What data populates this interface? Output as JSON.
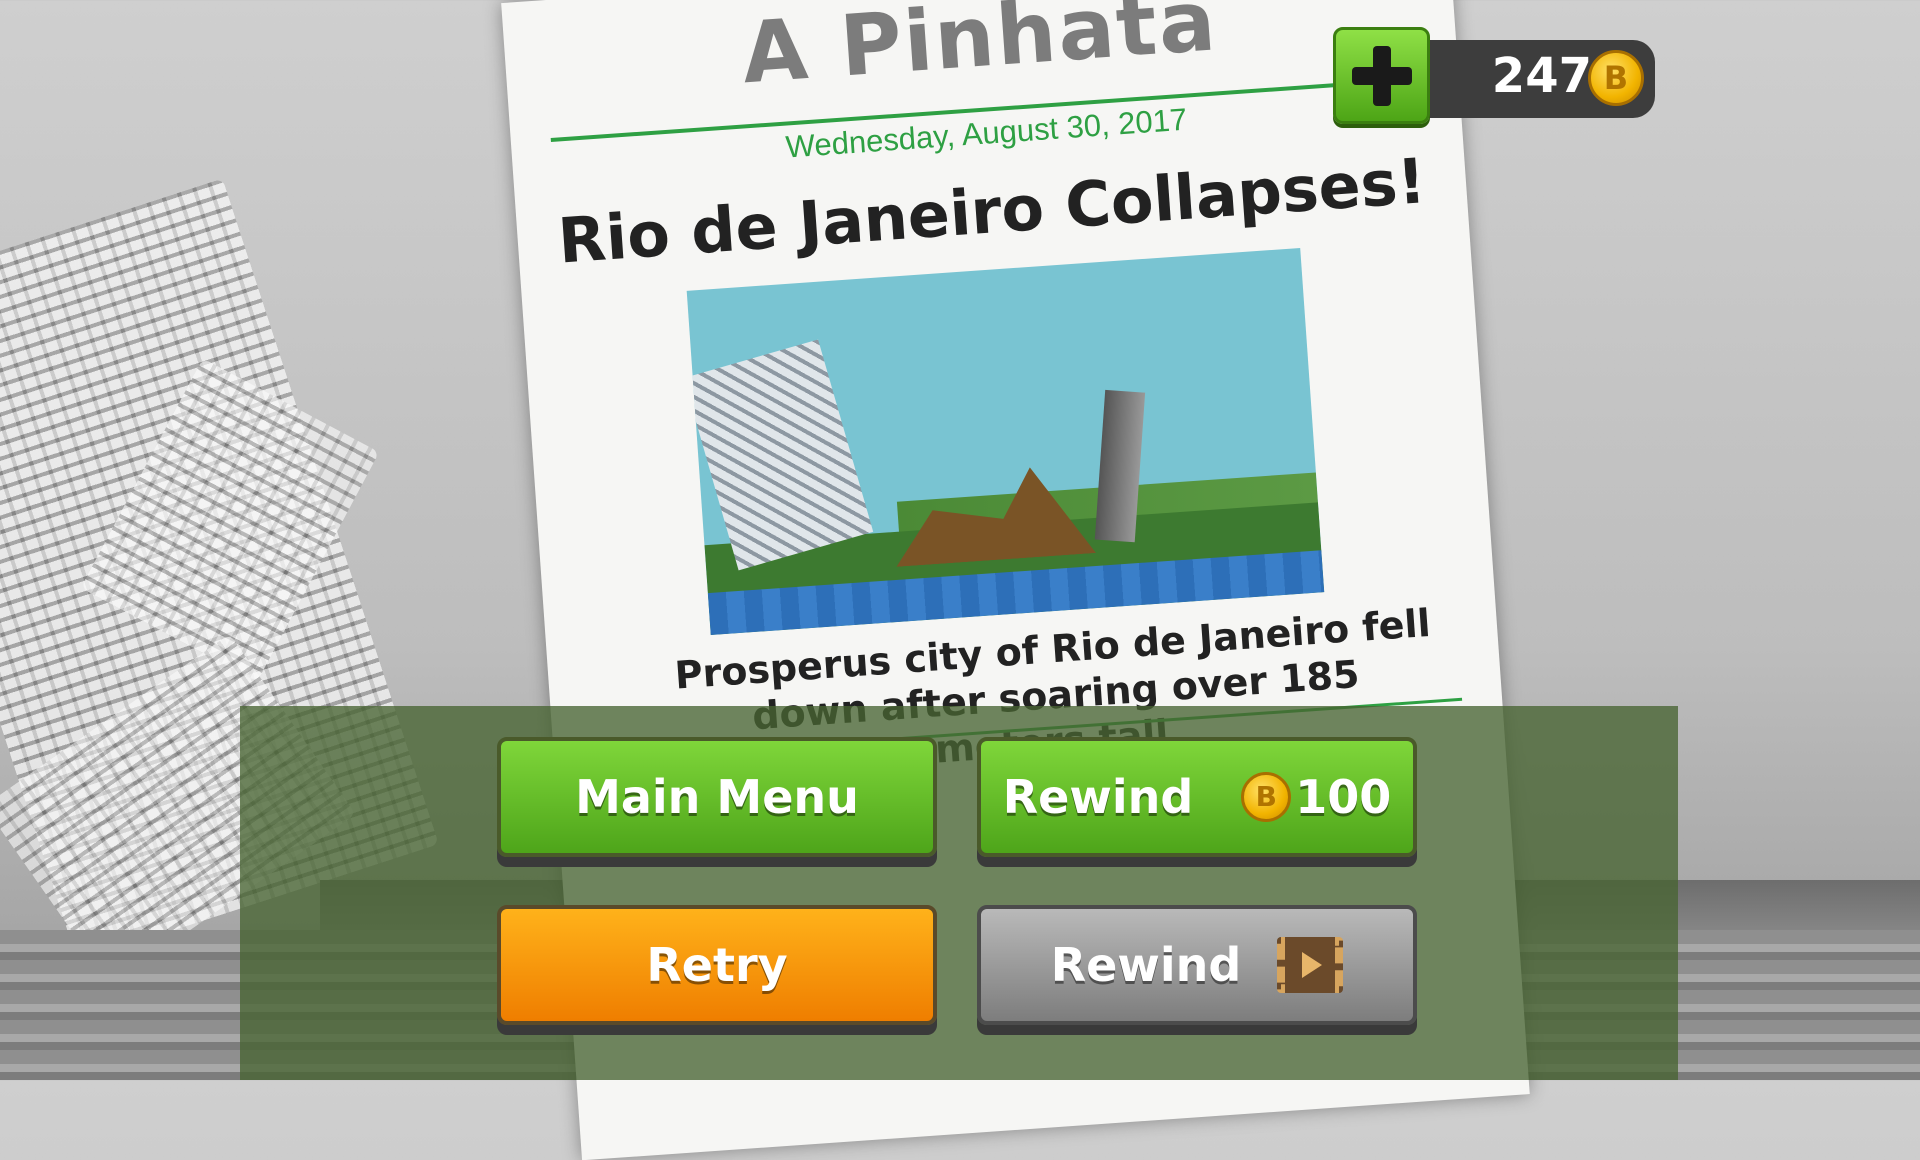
{
  "newspaper": {
    "title": "A Pinhata",
    "date": "Wednesday, August 30, 2017",
    "headline": "Rio de Janeiro Collapses!",
    "body": "Prosperus city of Rio de Janeiro fell down after soaring over 185 meters tall."
  },
  "currency": {
    "count": "247",
    "coin_symbol": "B",
    "add_icon": "plus-icon"
  },
  "buttons": {
    "main_menu": "Main Menu",
    "rewind_coin": "Rewind",
    "rewind_cost": "100",
    "retry": "Retry",
    "rewind_video": "Rewind",
    "video_icon": "video-ad-icon"
  },
  "colors": {
    "accent_green": "#2ea043",
    "button_green": "#4ea51a",
    "button_orange": "#ef7e00",
    "button_gray": "#7d7d7d"
  }
}
